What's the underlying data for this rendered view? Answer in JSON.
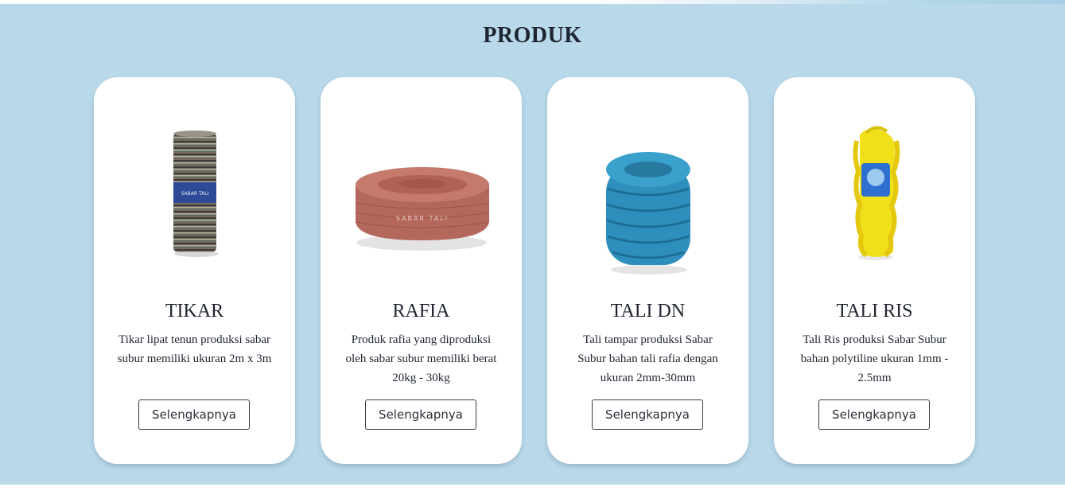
{
  "section": {
    "title": "PRODUK",
    "background_color": "#b9d9ea"
  },
  "products": [
    {
      "title": "TIKAR",
      "description": "Tikar lipat tenun produksi sabar subur memiliki ukuran 2m x 3m",
      "button_label": "Selengkapnya",
      "image_icon": "rolled-mat-icon",
      "image_text": "SABAR TALI"
    },
    {
      "title": "RAFIA",
      "description": "Produk rafia yang diproduksi oleh sabar subur memiliki berat 20kg - 30kg",
      "button_label": "Selengkapnya",
      "image_icon": "raffia-roll-icon",
      "image_text": "SABAR TALI"
    },
    {
      "title": "TALI DN",
      "description": "Tali tampar produksi Sabar Subur bahan tali rafia dengan ukuran 2mm-30mm",
      "button_label": "Selengkapnya",
      "image_icon": "rope-coil-icon"
    },
    {
      "title": "TALI RIS",
      "description": "Tali Ris produksi Sabar Subur bahan polytiline ukuran 1mm - 2.5mm",
      "button_label": "Selengkapnya",
      "image_icon": "yellow-rope-bundle-icon"
    }
  ]
}
